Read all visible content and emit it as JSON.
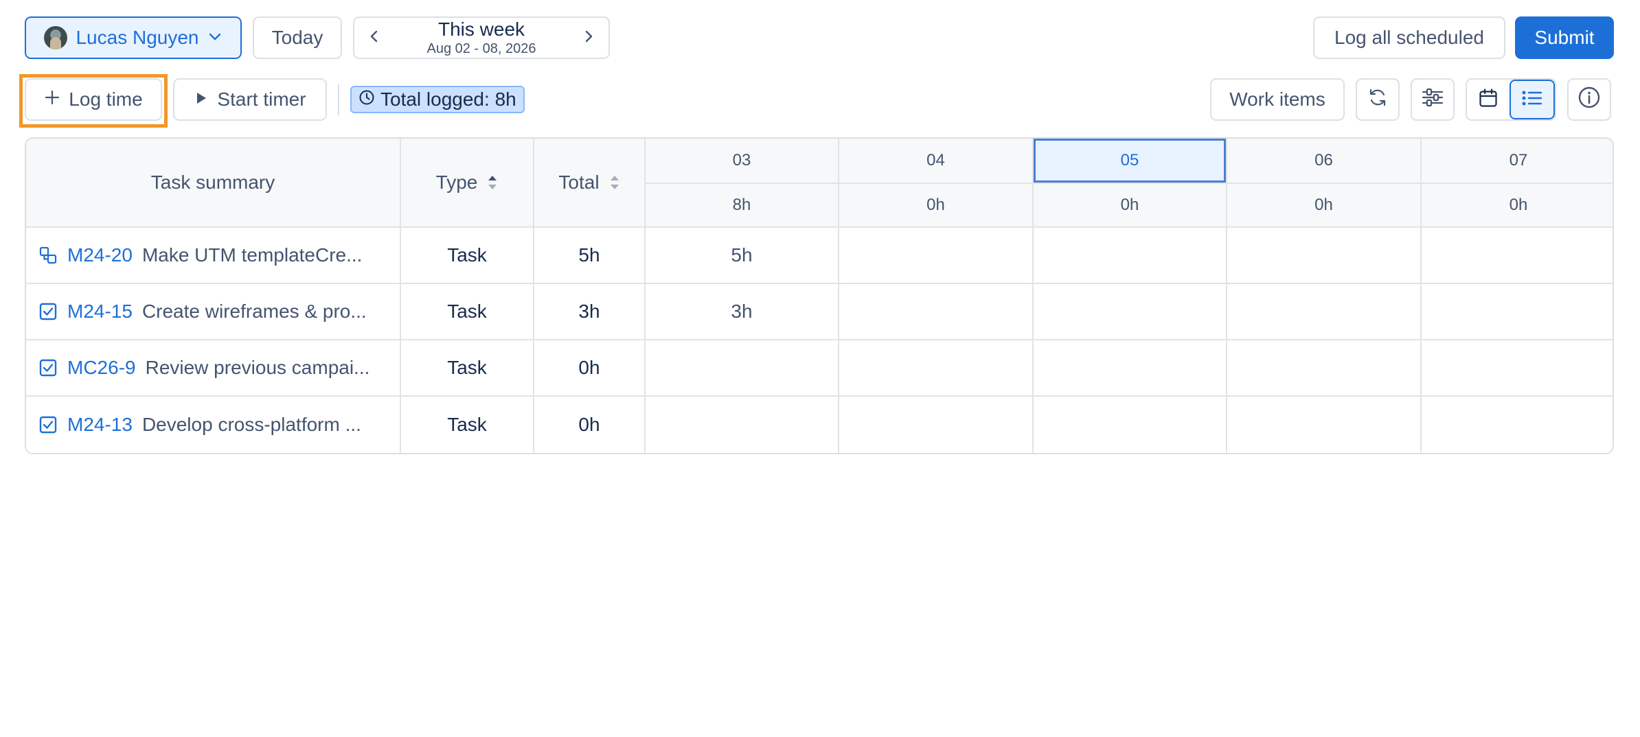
{
  "toolbar": {
    "user_name": "Lucas Nguyen",
    "today_label": "Today",
    "week_title": "This week",
    "week_range": "Aug 02 - 08, 2026",
    "log_all_label": "Log all scheduled",
    "submit_label": "Submit",
    "log_time_label": "Log time",
    "start_timer_label": "Start timer",
    "total_logged": "Total logged: 8h",
    "work_items_label": "Work items"
  },
  "table": {
    "headers": {
      "summary": "Task summary",
      "type": "Type",
      "total": "Total"
    },
    "days": [
      {
        "date": "03",
        "hours": "8h",
        "highlight": false
      },
      {
        "date": "04",
        "hours": "0h",
        "highlight": false
      },
      {
        "date": "05",
        "hours": "0h",
        "highlight": true
      },
      {
        "date": "06",
        "hours": "0h",
        "highlight": false
      },
      {
        "date": "07",
        "hours": "0h",
        "highlight": false
      }
    ],
    "rows": [
      {
        "icon": "subtask-icon",
        "key": "M24-20",
        "name": "Make UTM templateCre...",
        "type": "Task",
        "total": "5h",
        "days": [
          "5h",
          "",
          "",
          "",
          ""
        ]
      },
      {
        "icon": "task-checkbox-icon",
        "key": "M24-15",
        "name": "Create wireframes & pro...",
        "type": "Task",
        "total": "3h",
        "days": [
          "3h",
          "",
          "",
          "",
          ""
        ]
      },
      {
        "icon": "task-checkbox-icon",
        "key": "MC26-9",
        "name": "Review previous campai...",
        "type": "Task",
        "total": "0h",
        "days": [
          "",
          "",
          "",
          "",
          ""
        ]
      },
      {
        "icon": "task-checkbox-icon",
        "key": "M24-13",
        "name": "Develop cross-platform ...",
        "type": "Task",
        "total": "0h",
        "days": [
          "",
          "",
          "",
          "",
          ""
        ]
      }
    ]
  },
  "colors": {
    "primary": "#1d6fd8",
    "highlight_border": "#f29727",
    "badge_bg": "#cce0ff"
  }
}
